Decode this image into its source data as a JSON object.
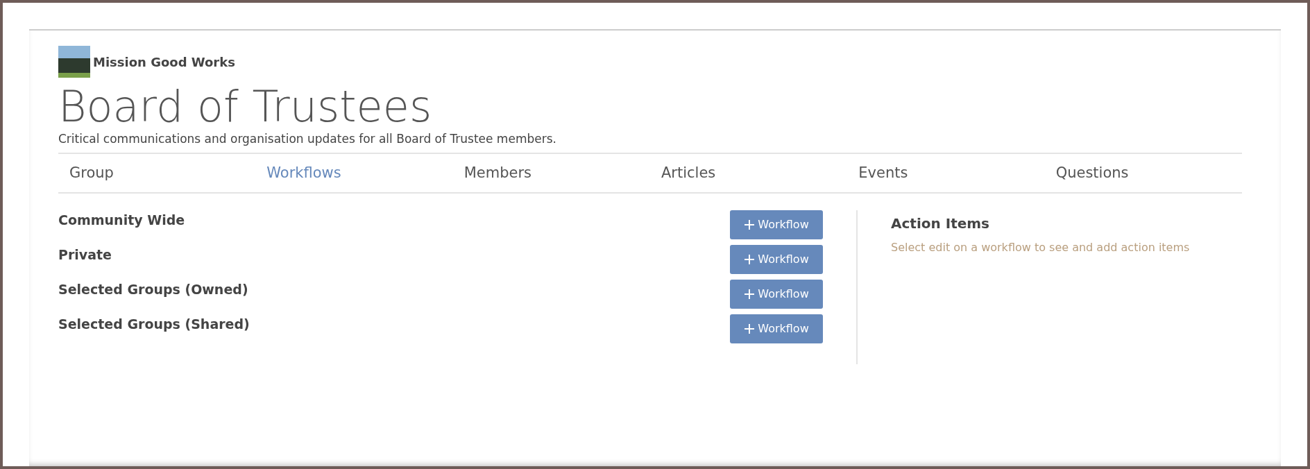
{
  "organisation": {
    "name": "Mission Good Works"
  },
  "page": {
    "title": "Board of Trustees",
    "subtitle": "Critical communications and organisation updates for all Board of Trustee members."
  },
  "tabs": [
    {
      "label": "Group",
      "selected": false
    },
    {
      "label": "Workflows",
      "selected": true
    },
    {
      "label": "Members",
      "selected": false
    },
    {
      "label": "Articles",
      "selected": false
    },
    {
      "label": "Events",
      "selected": false
    },
    {
      "label": "Questions",
      "selected": false
    }
  ],
  "workflow_sections": [
    {
      "label": "Community Wide",
      "button": "Workflow"
    },
    {
      "label": "Private",
      "button": "Workflow"
    },
    {
      "label": "Selected Groups (Owned)",
      "button": "Workflow"
    },
    {
      "label": "Selected Groups (Shared)",
      "button": "Workflow"
    }
  ],
  "action_items": {
    "title": "Action Items",
    "hint": "Select edit on a workflow to see and add action items"
  }
}
